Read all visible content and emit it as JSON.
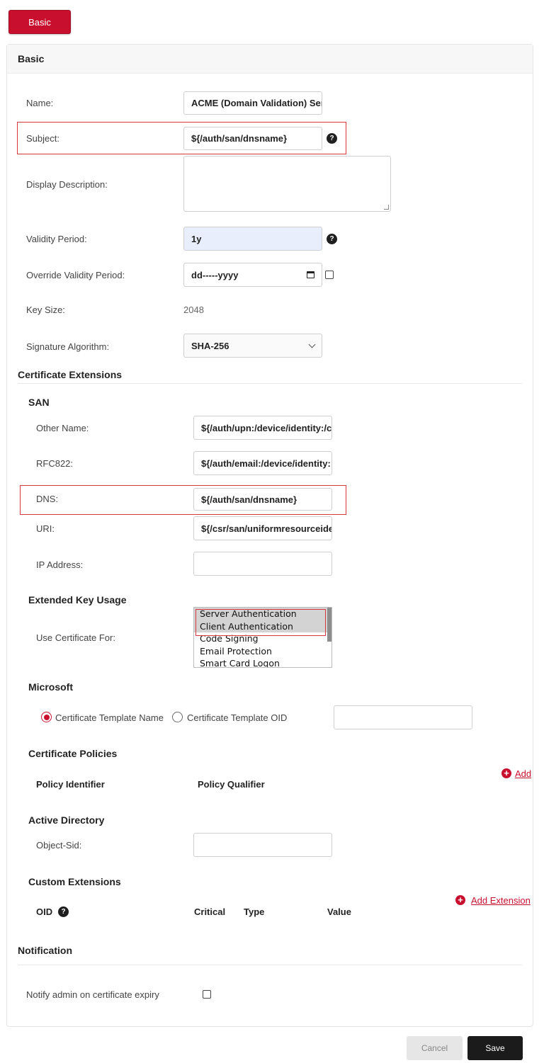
{
  "tab": {
    "label": "Basic"
  },
  "basic": {
    "heading": "Basic",
    "name": {
      "label": "Name:",
      "value": "ACME (Domain Validation) Ser"
    },
    "subject": {
      "label": "Subject:",
      "value": "${/auth/san/dnsname}"
    },
    "display_description": {
      "label": "Display Description:",
      "value": ""
    },
    "validity_period": {
      "label": "Validity Period:",
      "value": "1y"
    },
    "override_validity": {
      "label": "Override Validity Period:",
      "value": "dd-----yyyy"
    },
    "key_size": {
      "label": "Key Size:",
      "value": "2048"
    },
    "signature_algorithm": {
      "label": "Signature Algorithm:",
      "value": "SHA-256"
    }
  },
  "cert_ext": {
    "heading": "Certificate Extensions",
    "san": {
      "heading": "SAN",
      "other_name": {
        "label": "Other Name:",
        "value": "${/auth/upn:/device/identity:/c"
      },
      "rfc822": {
        "label": "RFC822:",
        "value": "${/auth/email:/device/identity:"
      },
      "dns": {
        "label": "DNS:",
        "value": "${/auth/san/dnsname}"
      },
      "uri": {
        "label": "URI:",
        "value": "${/csr/san/uniformresourceide"
      },
      "ip": {
        "label": "IP Address:",
        "value": ""
      }
    },
    "eku": {
      "heading": "Extended Key Usage",
      "label": "Use Certificate For:",
      "options": [
        "Server Authentication",
        "Client Authentication",
        "Code Signing",
        "Email Protection",
        "Smart Card Logon"
      ]
    },
    "microsoft": {
      "heading": "Microsoft",
      "radio_name": "Certificate Template Name",
      "radio_oid": "Certificate Template OID",
      "value": ""
    },
    "policies": {
      "heading": "Certificate Policies",
      "col_identifier": "Policy Identifier",
      "col_qualifier": "Policy Qualifier",
      "add": "Add"
    },
    "ad": {
      "heading": "Active Directory",
      "object_sid": {
        "label": "Object-Sid:",
        "value": ""
      }
    },
    "custom": {
      "heading": "Custom Extensions",
      "col_oid": "OID",
      "col_critical": "Critical",
      "col_type": "Type",
      "col_value": "Value",
      "add": "Add Extension"
    }
  },
  "notification": {
    "heading": "Notification",
    "notify_label": "Notify admin on certificate expiry"
  },
  "footer": {
    "cancel": "Cancel",
    "save": "Save"
  },
  "colors": {
    "accent": "#c8102e",
    "highlight": "#d9363e",
    "field_blue": "#e8eefc"
  },
  "icons": {
    "help": "question-circle-icon",
    "add": "plus-circle-icon",
    "calendar": "calendar-icon",
    "dropdown": "chevron-down-icon"
  }
}
